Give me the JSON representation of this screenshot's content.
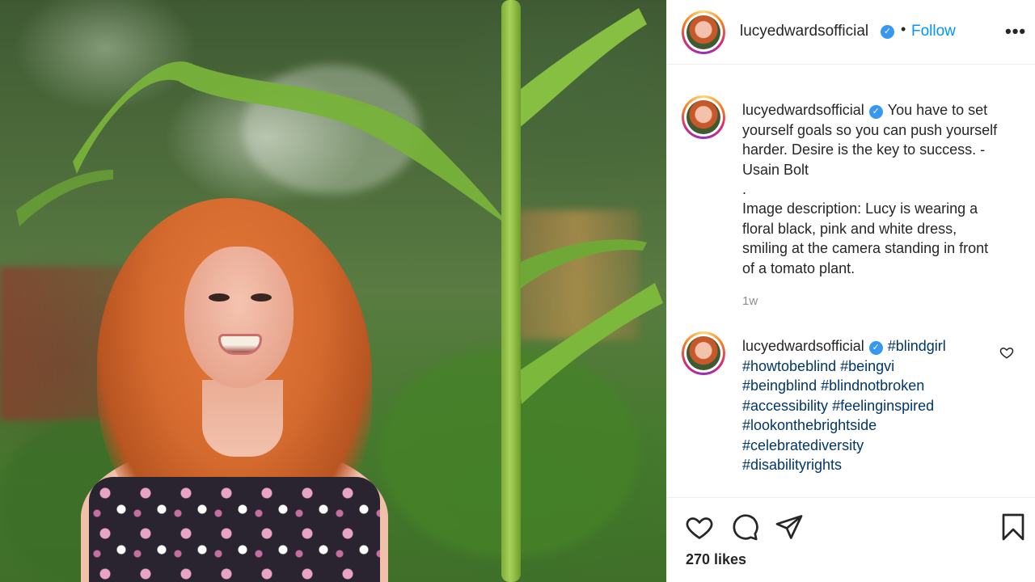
{
  "post": {
    "username": "lucyedwardsofficial",
    "verified": true,
    "follow_label": "Follow",
    "dot": "•",
    "more": "•••"
  },
  "caption": {
    "username": "lucyedwardsofficial",
    "lines": [
      "You have to set",
      "yourself goals so you can push yourself",
      "harder. Desire is the key to success. -",
      "Usain Bolt",
      ".",
      "Image description: Lucy is wearing a",
      "floral black, pink and white dress,",
      "smiling at the camera standing in front",
      "of a tomato plant."
    ],
    "time": "1w"
  },
  "comment": {
    "username": "lucyedwardsofficial",
    "hashtags": [
      [
        "#blindgirl"
      ],
      [
        "#howtobeblind",
        "#beingvi"
      ],
      [
        "#beingblind",
        "#blindnotbroken"
      ],
      [
        "#accessibility",
        "#feelinginspired"
      ],
      [
        "#lookonthebrightside"
      ],
      [
        "#celebratediversity"
      ],
      [
        "#disabilityrights"
      ]
    ]
  },
  "footer": {
    "likes": "270 likes"
  },
  "icons": {
    "like": "heart-icon",
    "comment": "comment-icon",
    "share": "share-icon",
    "save": "bookmark-icon"
  },
  "colors": {
    "accent": "#0095f6",
    "hashtag": "#00376b",
    "verified": "#3897f0",
    "muted": "#8e8e8e"
  }
}
